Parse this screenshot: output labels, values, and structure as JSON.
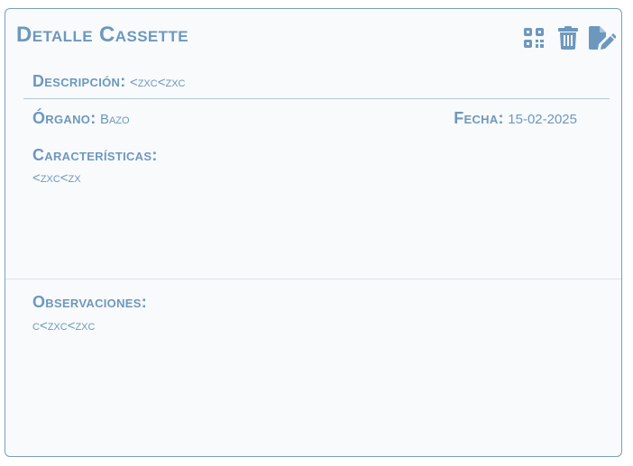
{
  "card": {
    "title": "Detalle Cassette",
    "actions": [
      {
        "name": "qr-code",
        "icon": "qr-code-icon"
      },
      {
        "name": "delete",
        "icon": "trash-icon"
      },
      {
        "name": "edit",
        "icon": "file-edit-icon"
      }
    ],
    "descripcion": {
      "label": "Descripción:",
      "value": "<zxc<zxc"
    },
    "organo": {
      "label": "Órgano:",
      "value": "Bazo"
    },
    "fecha": {
      "label": "Fecha:",
      "value": "15-02-2025"
    },
    "caracteristicas": {
      "label": "Características:",
      "value": "<zxc<zx"
    },
    "observaciones": {
      "label": "Observaciones:",
      "value": "c<zxc<zxc"
    }
  },
  "colors": {
    "accent": "#6d98bd",
    "border": "#7a9fbd",
    "background": "#f8fafc"
  }
}
